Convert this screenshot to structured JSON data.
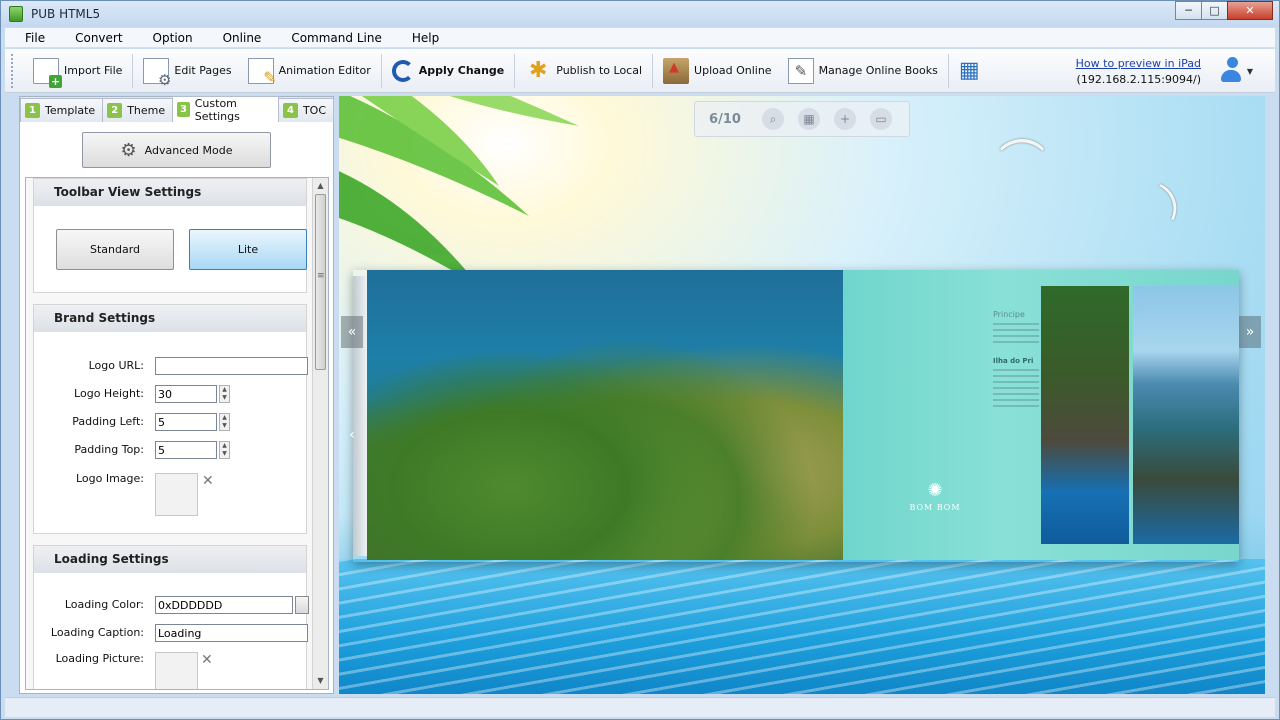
{
  "window": {
    "title": "PUB HTML5",
    "min": "─",
    "max": "□",
    "close": "✕"
  },
  "menu": [
    {
      "label": "File"
    },
    {
      "label": "Convert"
    },
    {
      "label": "Option"
    },
    {
      "label": "Online"
    },
    {
      "label": "Command Line"
    },
    {
      "label": "Help"
    }
  ],
  "toolbar": {
    "import_file": "Import File",
    "edit_pages": "Edit Pages",
    "animation_editor": "Animation Editor",
    "apply_change": "Apply Change",
    "publish_local": "Publish to Local",
    "upload_online": "Upload Online",
    "manage_online": "Manage Online Books",
    "ipad_link": "How to preview in iPad",
    "ipad_address": "(192.168.2.115:9094/)"
  },
  "tabs": [
    {
      "num": "1",
      "label": "Template"
    },
    {
      "num": "2",
      "label": "Theme"
    },
    {
      "num": "3",
      "label": "Custom Settings"
    },
    {
      "num": "4",
      "label": "TOC"
    }
  ],
  "advanced_mode": "Advanced Mode",
  "toolbar_view": {
    "title": "Toolbar View Settings",
    "standard": "Standard",
    "lite": "Lite"
  },
  "brand": {
    "title": "Brand Settings",
    "logo_url_label": "Logo URL:",
    "logo_url_value": "",
    "logo_height_label": "Logo Height:",
    "logo_height_value": "30",
    "padding_left_label": "Padding Left:",
    "padding_left_value": "5",
    "padding_top_label": "Padding Top:",
    "padding_top_value": "5",
    "logo_image_label": "Logo Image:"
  },
  "loading": {
    "title": "Loading Settings",
    "color_label": "Loading Color:",
    "color_value": "0xDDDDDD",
    "caption_label": "Loading Caption:",
    "caption_value": "Loading",
    "picture_label": "Loading Picture:"
  },
  "preview": {
    "page_counter": "6/10",
    "page_heading": "Principe",
    "page_subheading": "Ilha do Pri",
    "brand_name": "BOM BOM"
  }
}
